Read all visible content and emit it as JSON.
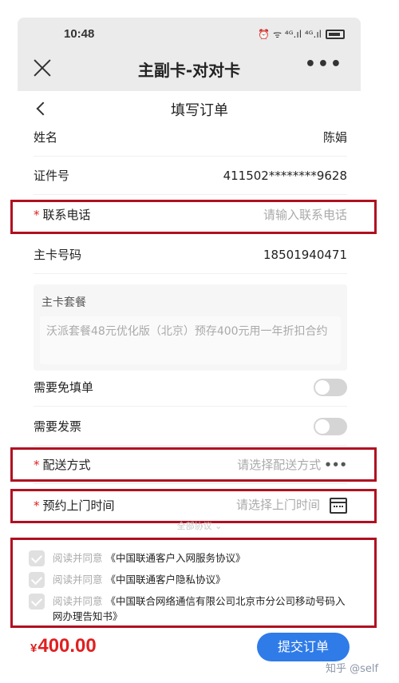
{
  "status_bar": {
    "time": "10:48",
    "icons": "⏰ ᯤ ⁴ᴳ.ıl ⁴ᴳ.ıl"
  },
  "nav": {
    "title": "主副卡-对对卡",
    "more": "•••"
  },
  "page": {
    "title": "填写订单"
  },
  "fields": {
    "name": {
      "label": "姓名",
      "value": "陈娟"
    },
    "id_number": {
      "label": "证件号",
      "value": "411502********9628"
    },
    "phone": {
      "required": "*",
      "label": "联系电话",
      "placeholder": "请输入联系电话"
    },
    "main_card": {
      "label": "主卡号码",
      "value": "18501940471"
    },
    "plan": {
      "label": "主卡套餐",
      "value": "沃派套餐48元优化版（北京）预存400元用一年折扣合约"
    },
    "fill_form": {
      "label": "需要免填单"
    },
    "invoice": {
      "label": "需要发票"
    },
    "delivery": {
      "required": "*",
      "label": "配送方式",
      "placeholder": "请选择配送方式",
      "more": "•••"
    },
    "appointment": {
      "required": "*",
      "label": "预约上门时间",
      "placeholder": "请选择上门时间"
    }
  },
  "collapse_text": "全部协议 ⌄",
  "agreements": [
    {
      "prefix": "阅读并同意",
      "link": "《中国联通客户入网服务协议》"
    },
    {
      "prefix": "阅读并同意",
      "link": "《中国联通客户隐私协议》"
    },
    {
      "prefix": "阅读并同意",
      "link": "《中国联合网络通信有限公司北京市分公司移动号码入网办理告知书》"
    }
  ],
  "footer": {
    "currency": "¥",
    "amount": "400.00",
    "submit_label": "提交订单",
    "watermark": "知乎 @self"
  },
  "colors": {
    "accent": "#2f7be8",
    "price": "#e02020",
    "highlight_border": "#b01020"
  }
}
